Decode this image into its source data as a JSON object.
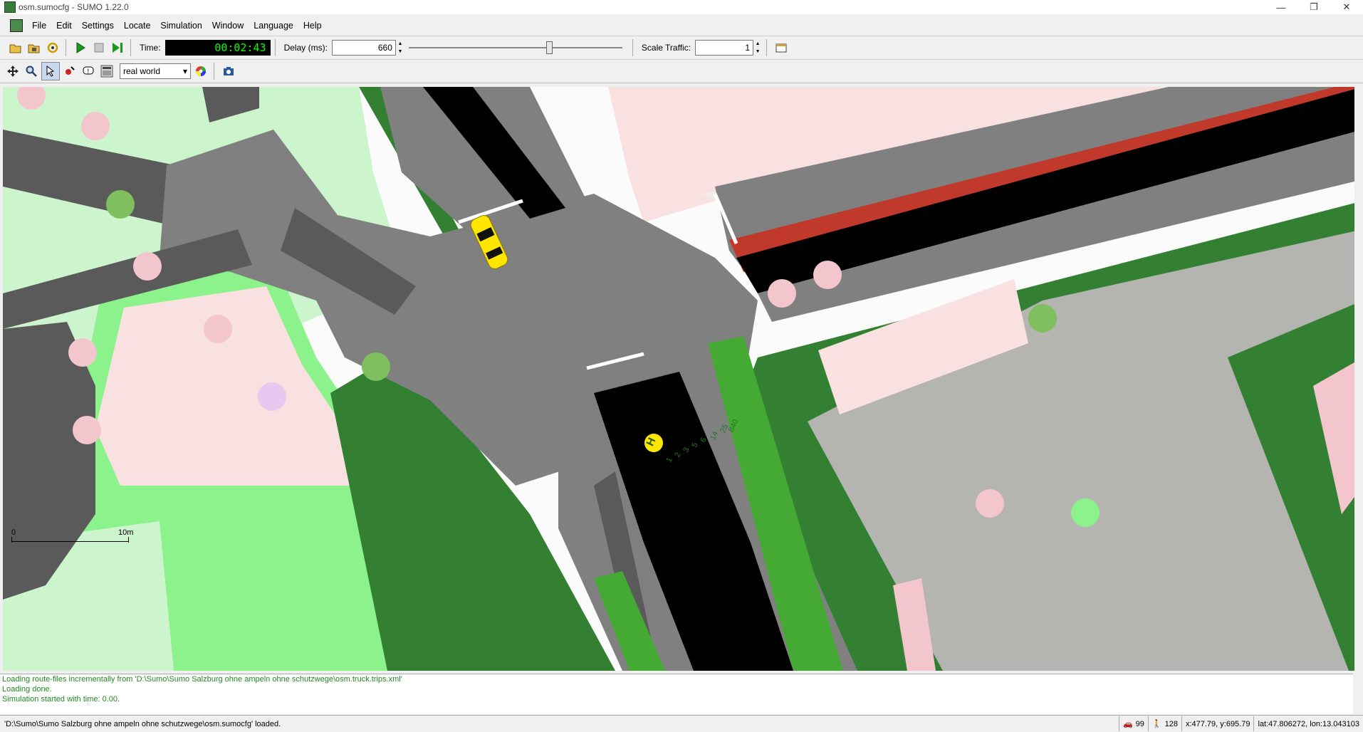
{
  "window": {
    "title": "osm.sumocfg - SUMO 1.22.0",
    "controls": [
      "—",
      "❐",
      "✕"
    ]
  },
  "menu": [
    "File",
    "Edit",
    "Settings",
    "Locate",
    "Simulation",
    "Window",
    "Language",
    "Help"
  ],
  "toolbar": {
    "time_label": "Time:",
    "time_value": "00:02:43",
    "delay_label": "Delay (ms):",
    "delay_value": "660",
    "delay_fraction": 0.66,
    "scale_label": "Scale Traffic:",
    "scale_value": "1"
  },
  "view_toolbar": {
    "scheme": "real world"
  },
  "scale_bar": {
    "zero": "0",
    "max": "10m"
  },
  "bus_stop": {
    "symbol": "H",
    "lines": [
      "840",
      "25",
      "14",
      "6",
      "5",
      "3",
      "2",
      "1"
    ]
  },
  "messages": [
    "Loading route-files incrementally from 'D:\\Sumo\\Sumo Salzburg ohne ampeln ohne schutzwege\\osm.truck.trips.xml'",
    "Loading done.",
    "Simulation started with time: 0.00."
  ],
  "status": {
    "message": "'D:\\Sumo\\Sumo Salzburg ohne ampeln ohne schutzwege\\osm.sumocfg' loaded.",
    "vehicles": "99",
    "persons": "128",
    "xy": "x:477.79, y:695.79",
    "latlon": "lat:47.806272, lon:13.043103"
  },
  "colors": {
    "road": "#808080",
    "sidewalk": "#5a5a5a",
    "lane": "#000000",
    "grass": "#cdf5cd",
    "forest": "#338033",
    "green": "#8cf28c",
    "building": "#fae1e1",
    "area": "#b4b4b0",
    "bus_lane": "#c0392b",
    "vehicle": "#ffe600"
  }
}
